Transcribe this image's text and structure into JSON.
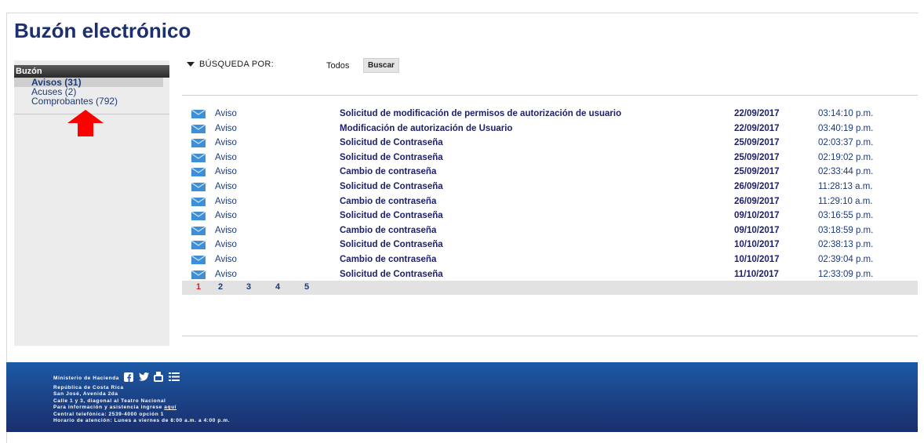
{
  "page": {
    "title": "Buzón electrónico"
  },
  "sidebar": {
    "header": "Buzón",
    "items": [
      {
        "label": "Avisos (31)"
      },
      {
        "label": "Acuses (2)"
      },
      {
        "label": "Comprobantes (792)"
      }
    ]
  },
  "search": {
    "label": "BÚSQUEDA POR:",
    "filter_value": "Todos",
    "button_label": "Buscar"
  },
  "messages": [
    {
      "type": "Aviso",
      "subject": "Solicitud de modificación de permisos de autorización de usuario",
      "date": "22/09/2017",
      "time": "03:14:10 p.m."
    },
    {
      "type": "Aviso",
      "subject": "Modificación de autorización de Usuario",
      "date": "22/09/2017",
      "time": "03:40:19 p.m."
    },
    {
      "type": "Aviso",
      "subject": "Solicitud de Contraseña",
      "date": "25/09/2017",
      "time": "02:03:37 p.m."
    },
    {
      "type": "Aviso",
      "subject": "Solicitud de Contraseña",
      "date": "25/09/2017",
      "time": "02:19:02 p.m."
    },
    {
      "type": "Aviso",
      "subject": "Cambio de contraseña",
      "date": "25/09/2017",
      "time": "02:33:44 p.m."
    },
    {
      "type": "Aviso",
      "subject": "Solicitud de Contraseña",
      "date": "26/09/2017",
      "time": "11:28:13 a.m."
    },
    {
      "type": "Aviso",
      "subject": "Cambio de contraseña",
      "date": "26/09/2017",
      "time": "11:29:10 a.m."
    },
    {
      "type": "Aviso",
      "subject": "Solicitud de Contraseña",
      "date": "09/10/2017",
      "time": "03:16:55 p.m."
    },
    {
      "type": "Aviso",
      "subject": "Cambio de contraseña",
      "date": "09/10/2017",
      "time": "03:18:59 p.m."
    },
    {
      "type": "Aviso",
      "subject": "Solicitud de Contraseña",
      "date": "10/10/2017",
      "time": "02:38:13 p.m."
    },
    {
      "type": "Aviso",
      "subject": "Cambio de contraseña",
      "date": "10/10/2017",
      "time": "02:39:04 p.m."
    },
    {
      "type": "Aviso",
      "subject": "Solicitud de Contraseña",
      "date": "11/10/2017",
      "time": "12:33:09 p.m."
    }
  ],
  "pagination": {
    "pages": [
      "1",
      "2",
      "3",
      "4",
      "5"
    ],
    "current": "1"
  },
  "footer": {
    "org": "Ministerio de Hacienda",
    "lines": [
      "República de Costa Rica",
      "San José, Avenida 2da",
      "Calle 1 y 3, diagonal al Teatro Nacional"
    ],
    "help_prefix": "Para información y asistencia ingrese",
    "help_link": "aquí",
    "phone": "Central telefónica: 2539-4000 opción 1",
    "hours": "Horario de atención: Lunes a viernes de 8:00 a.m. a 4:00 p.m."
  },
  "icons": {
    "envelope": "envelope-icon",
    "annotation": "red-up-arrow-icon",
    "social": [
      "facebook-icon",
      "twitter-icon",
      "youtube-icon",
      "list-icon"
    ]
  },
  "colors": {
    "title": "#1c2f6e",
    "link": "#1d3a78",
    "subject": "#1c1f6e",
    "current_page": "#e02020",
    "annotation_arrow": "#ff0000",
    "footer_bg": "#1b3f82"
  }
}
